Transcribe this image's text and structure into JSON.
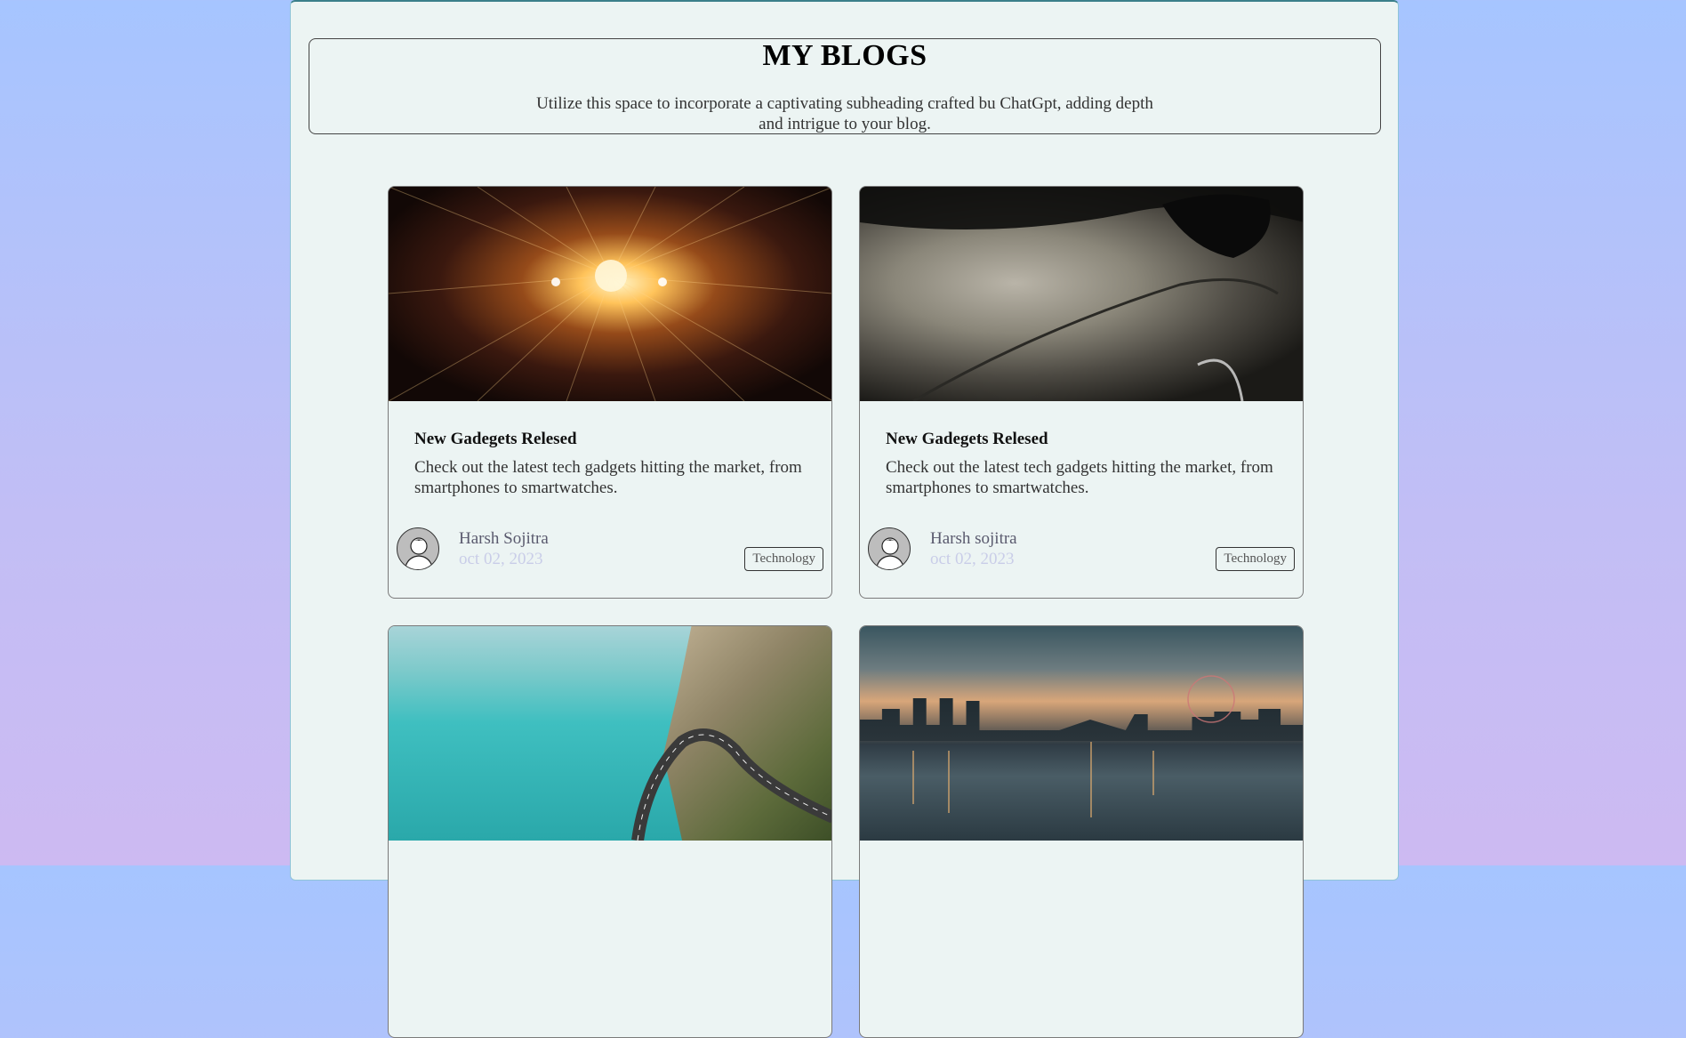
{
  "header": {
    "title": "MY BLOGS",
    "subtitle": "Utilize this space to incorporate a captivating subheading crafted bu ChatGpt, adding depth and intrigue to your blog."
  },
  "cards": [
    {
      "image": "tunnel-lights-photo",
      "title": "New Gadegets Relesed",
      "description": "Check out the latest tech gadgets hitting the market, from smartphones to smartwatches.",
      "author": "Harsh Sojitra",
      "date": "oct 02, 2023",
      "tag": "Technology"
    },
    {
      "image": "silver-car-photo",
      "title": "New Gadegets Relesed",
      "description": "Check out the latest tech gadgets hitting the market, from smartphones to smartwatches.",
      "author": "Harsh sojitra",
      "date": "oct 02, 2023",
      "tag": "Technology"
    },
    {
      "image": "coastal-road-photo"
    },
    {
      "image": "city-skyline-photo"
    }
  ],
  "colors": {
    "background_top": "#a6c5ff",
    "background_bottom": "#cdbaf2",
    "container": "#ecf4f3",
    "date_text": "#c9cde8"
  }
}
